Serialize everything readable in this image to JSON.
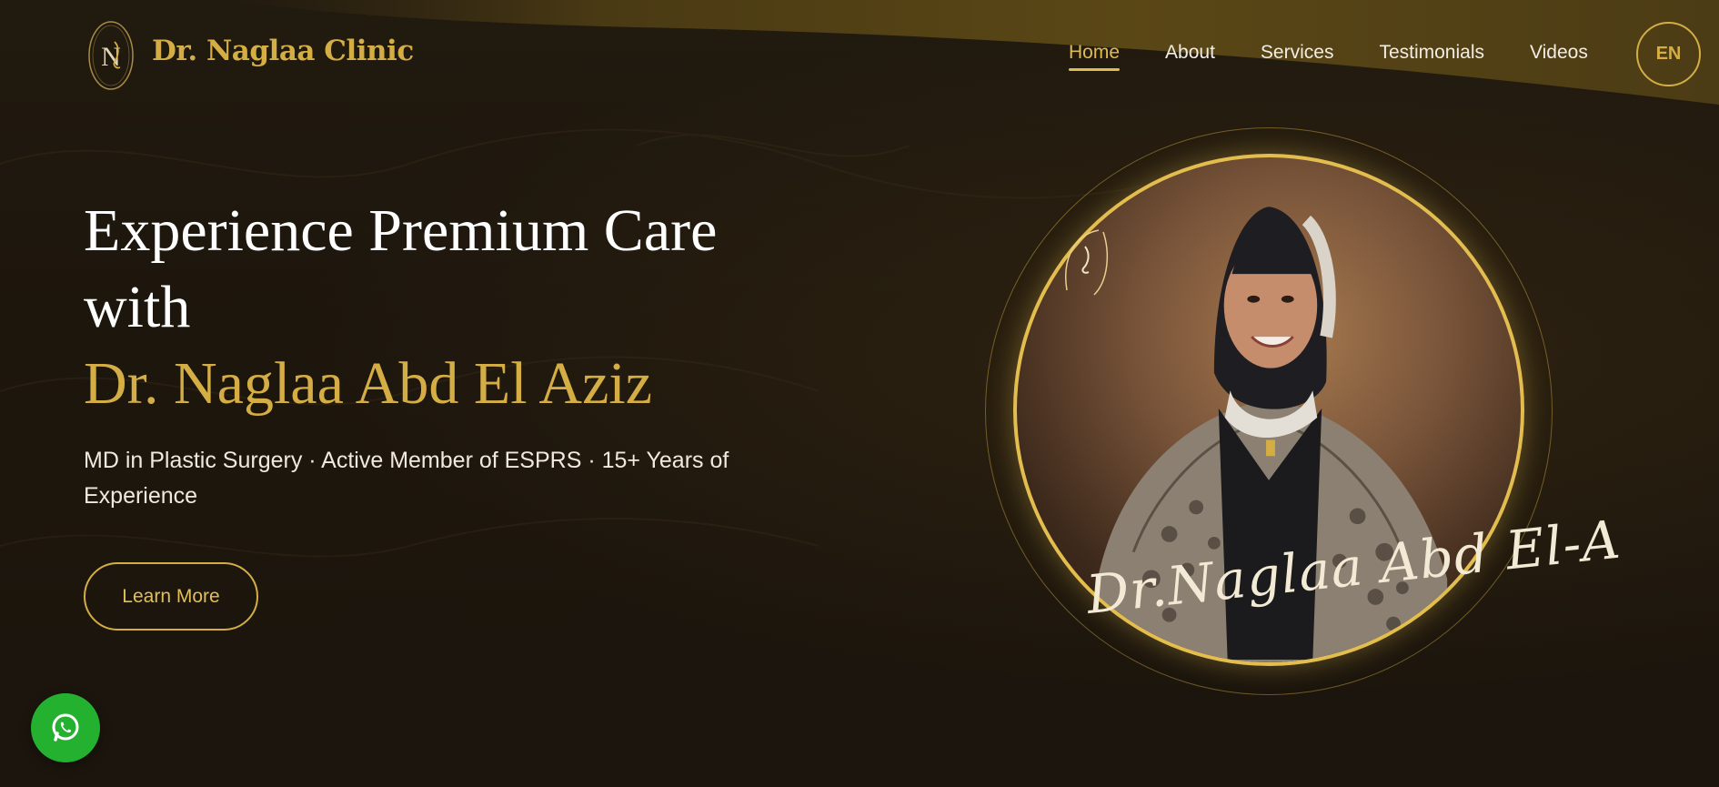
{
  "colors": {
    "accent_gold": "#d4ae45",
    "background": "#1c150d",
    "text_light": "#f2ede4",
    "whatsapp_green": "#25b130"
  },
  "header": {
    "brand_name": "Dr. Naglaa Clinic",
    "logo_icon": "naglaa-monogram-logo",
    "nav": {
      "home": "Home",
      "about": "About",
      "services": "Services",
      "testimonials": "Testimonials",
      "videos": "Videos"
    },
    "active_nav": "Home",
    "language_button": "EN"
  },
  "hero": {
    "headline_line1": "Experience Premium Care",
    "headline_line2": "with",
    "headline_name": "Dr. Naglaa Abd El Aziz",
    "subtitle": "MD in Plastic Surgery · Active Member of ESPRS · 15+ Years of Experience",
    "cta_label": "Learn More"
  },
  "portrait": {
    "signature": "Dr.Naglaa Abd El-A",
    "badge_icon": "clinic-logo-badge"
  },
  "floating": {
    "whatsapp_icon": "whatsapp-icon"
  }
}
